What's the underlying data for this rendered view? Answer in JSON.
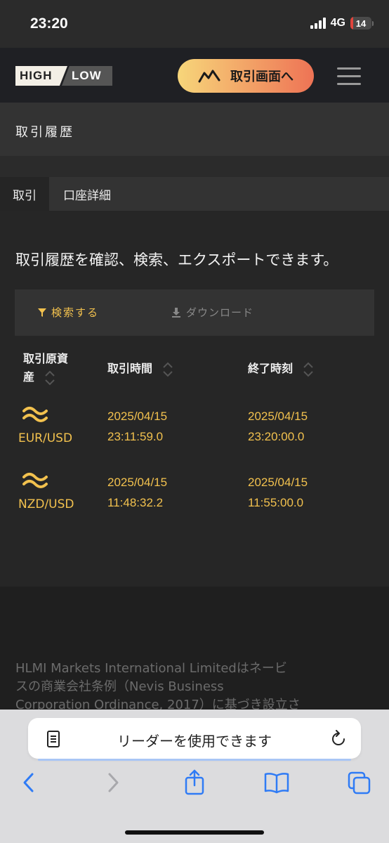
{
  "status": {
    "time": "23:20",
    "network": "4G",
    "battery": "14"
  },
  "header": {
    "logo_high": "HIGH",
    "logo_low": "LOW",
    "trade_button": "取引画面へ"
  },
  "page_title": "取引履歴",
  "tabs": [
    {
      "label": "取引",
      "active": true
    },
    {
      "label": "口座詳細",
      "active": false
    }
  ],
  "description": "取引履歴を確認、検索、エクスポートできます。",
  "toolbar": {
    "search": "検索する",
    "download": "ダウンロード"
  },
  "table": {
    "headers": {
      "asset_line1": "取引原資",
      "asset_line2": "産",
      "trade_time": "取引時間",
      "end_time": "終了時刻"
    },
    "rows": [
      {
        "asset": "EUR/USD",
        "trade_date": "2025/04/15",
        "trade_time": "23:11:59.0",
        "end_date": "2025/04/15",
        "end_time": "23:20:00.0"
      },
      {
        "asset": "NZD/USD",
        "trade_date": "2025/04/15",
        "trade_time": "11:48:32.2",
        "end_date": "2025/04/15",
        "end_time": "11:55:00.0"
      }
    ]
  },
  "footer": {
    "line1": "HLMI Markets International Limitedはネービ",
    "line2": "スの商業会社条例（Nevis Business",
    "line3": "Corporation Ordinance, 2017）に基づき設立さ"
  },
  "safari": {
    "reader_banner": "リーダーを使用できます"
  },
  "colors": {
    "accent": "#f2c14e",
    "button_gradient_start": "#f7d67a",
    "button_gradient_end": "#ee7355"
  }
}
